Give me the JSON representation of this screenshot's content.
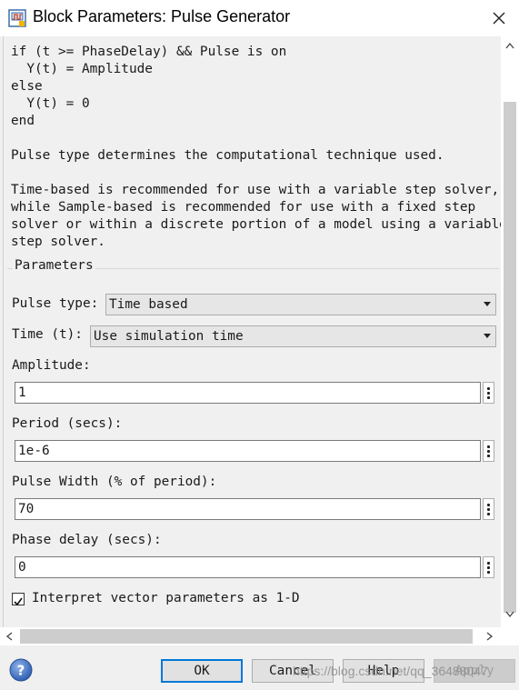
{
  "window": {
    "title": "Block Parameters: Pulse Generator",
    "app_icon": "simulink-block-icon",
    "close_icon": "close-icon"
  },
  "description": {
    "text": "if (t >= PhaseDelay) && Pulse is on\n  Y(t) = Amplitude\nelse\n  Y(t) = 0\nend\n\nPulse type determines the computational technique used.\n\nTime-based is recommended for use with a variable step solver,\nwhile Sample-based is recommended for use with a fixed step\nsolver or within a discrete portion of a model using a variable\nstep solver."
  },
  "parameters": {
    "group_title": "Parameters",
    "pulse_type": {
      "label": "Pulse type:",
      "value": "Time based"
    },
    "time": {
      "label": "Time (t):",
      "value": "Use simulation time"
    },
    "amplitude": {
      "label": "Amplitude:",
      "value": "1"
    },
    "period": {
      "label": "Period (secs):",
      "value": "1e-6"
    },
    "pulse_width": {
      "label": "Pulse Width (% of period):",
      "value": "70"
    },
    "phase_delay": {
      "label": "Phase delay (secs):",
      "value": "0"
    },
    "interpret_vector": {
      "label": "Interpret vector parameters as 1-D",
      "checked": true
    }
  },
  "buttons": {
    "ok": "OK",
    "cancel": "Cancel",
    "help": "Help",
    "apply": "Apply"
  },
  "watermark": "https://blog.csdn.net/qq_36488047"
}
